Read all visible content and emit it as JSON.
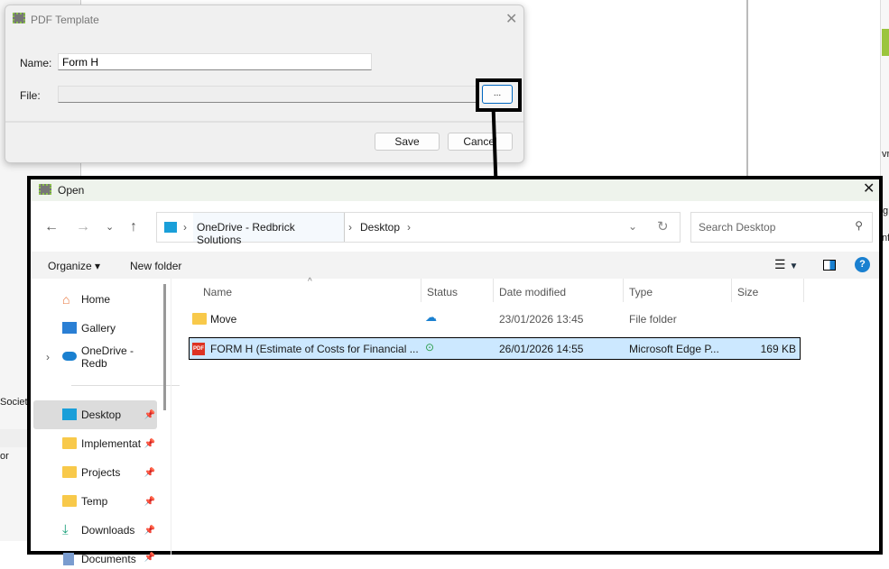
{
  "background": {
    "partial_texts": [
      "Society",
      "or",
      "vr",
      "g",
      "nf"
    ]
  },
  "template_dialog": {
    "title": "PDF Template",
    "name_label": "Name:",
    "name_value": "Form H",
    "file_label": "File:",
    "file_value": "",
    "browse_label": "...",
    "save_label": "Save",
    "cancel_label": "Cancel"
  },
  "open_dialog": {
    "title": "Open",
    "breadcrumb": [
      "OneDrive - Redbrick Solutions",
      "Desktop"
    ],
    "search_placeholder": "Search Desktop",
    "organize_label": "Organize",
    "new_folder_label": "New folder",
    "nav_items": [
      {
        "label": "Home"
      },
      {
        "label": "Gallery"
      },
      {
        "label": "OneDrive - Redb"
      },
      {
        "label": "Desktop"
      },
      {
        "label": "Implementat"
      },
      {
        "label": "Projects"
      },
      {
        "label": "Temp"
      },
      {
        "label": "Downloads"
      },
      {
        "label": "Documents"
      }
    ],
    "columns": [
      "Name",
      "Status",
      "Date modified",
      "Type",
      "Size"
    ],
    "files": [
      {
        "name": "Move",
        "date": "23/01/2026 13:45",
        "type": "File folder",
        "size": ""
      },
      {
        "name": "FORM H (Estimate of Costs for Financial ...",
        "date": "26/01/2026 14:55",
        "type": "Microsoft Edge P...",
        "size": "169 KB"
      }
    ],
    "pdf_badge": "PDF"
  },
  "colors": {
    "accent": "#0067c0",
    "selected": "#cce8ff",
    "brand_green": "#8bc34a"
  }
}
